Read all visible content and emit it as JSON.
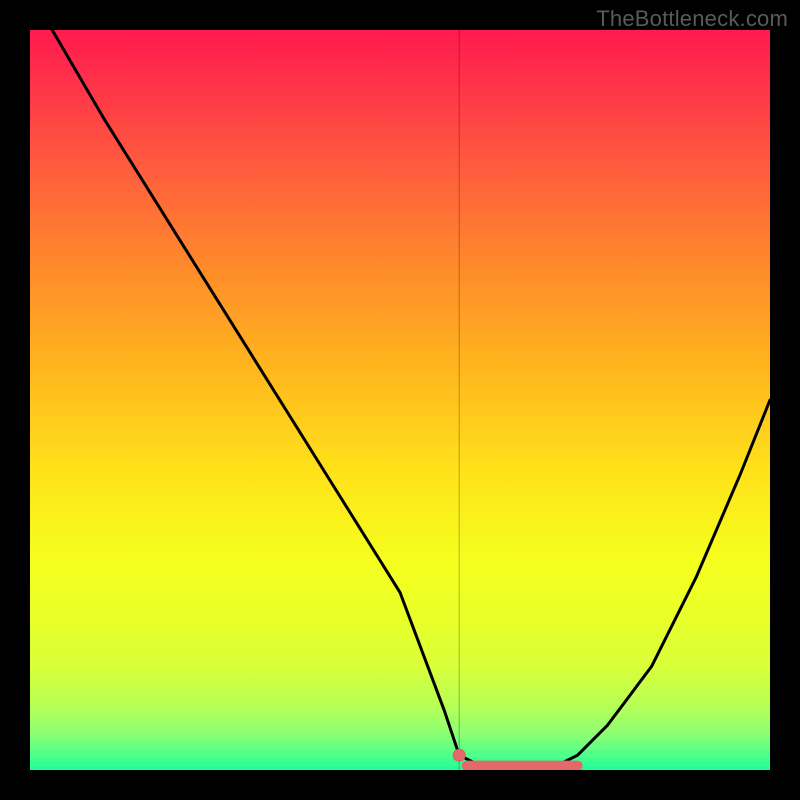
{
  "watermark": "TheBottleneck.com",
  "colors": {
    "curve": "#000000",
    "marker_fill": "#e46a6a",
    "marker_stroke": "#d85a5a",
    "indicator": "rgba(0,0,0,0.28)",
    "gradient_top": "#ff1a4f",
    "gradient_bottom": "#1cff97"
  },
  "chart_data": {
    "type": "line",
    "title": "",
    "xlabel": "",
    "ylabel": "",
    "xlim": [
      0,
      100
    ],
    "ylim": [
      0,
      100
    ],
    "grid": false,
    "legend": false,
    "annotations": [
      "TheBottleneck.com"
    ],
    "indicator_x": 58,
    "series": [
      {
        "name": "bottleneck-curve",
        "x": [
          3,
          10,
          20,
          30,
          40,
          50,
          56,
          58,
          62,
          66,
          70,
          74,
          78,
          84,
          90,
          96,
          100
        ],
        "values": [
          100,
          88,
          72,
          56,
          40,
          24,
          8,
          2,
          0,
          0,
          0,
          2,
          6,
          14,
          26,
          40,
          50
        ]
      }
    ],
    "markers": [
      {
        "name": "start-dot",
        "x": 58,
        "y": 2,
        "r": 6
      },
      {
        "name": "flat-segment",
        "x0": 59,
        "x1": 74,
        "y": 0.6,
        "thickness": 10
      }
    ]
  }
}
